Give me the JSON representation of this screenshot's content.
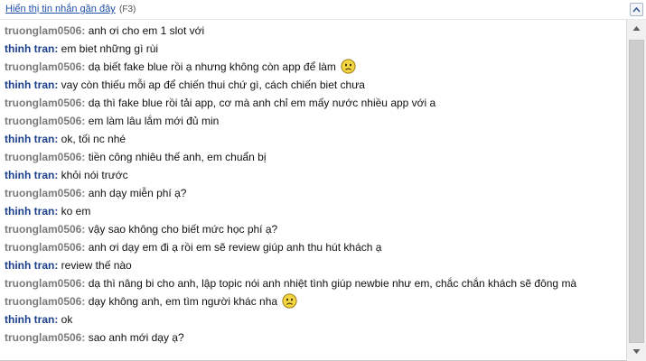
{
  "header": {
    "recent_link": "Hiển thị tin nhắn gần đây",
    "hotkey": "(F3)"
  },
  "messages": [
    {
      "sender": "truonglam0506:",
      "text": "anh ơi cho em 1 slot với",
      "role": "me"
    },
    {
      "sender": "thinh tran:",
      "text": "em biet những gì rùi",
      "role": "them"
    },
    {
      "sender": "truonglam0506:",
      "text": "dạ biết fake blue rồi ạ nhưng không còn app để làm",
      "role": "me",
      "emoticon": "sad-face"
    },
    {
      "sender": "thinh tran:",
      "text": "vay còn thiếu mỗi ap để chiến thui chứ gì, cách chiến biet chưa",
      "role": "them"
    },
    {
      "sender": "truonglam0506:",
      "text": "dạ thì fake blue rồi tải app, cơ mà anh chỉ em mấy nước nhiều app với a",
      "role": "me"
    },
    {
      "sender": "truonglam0506:",
      "text": "em làm lâu lắm mới đủ min",
      "role": "me"
    },
    {
      "sender": "thinh tran:",
      "text": "ok, tối nc nhé",
      "role": "them"
    },
    {
      "sender": "truonglam0506:",
      "text": "tiền công nhiêu thế anh, em chuẩn bị",
      "role": "me"
    },
    {
      "sender": "thinh tran:",
      "text": "khỏi nói trước",
      "role": "them"
    },
    {
      "sender": "truonglam0506:",
      "text": "anh dạy miễn phí ạ?",
      "role": "me"
    },
    {
      "sender": "thinh tran:",
      "text": "ko em",
      "role": "them"
    },
    {
      "sender": "truonglam0506:",
      "text": "vậy sao không cho biết mức học phí ạ?",
      "role": "me"
    },
    {
      "sender": "truonglam0506:",
      "text": "anh ơi dạy em đi ạ rồi em sẽ review giúp anh thu hút khách ạ",
      "role": "me"
    },
    {
      "sender": "thinh tran:",
      "text": "review thế nào",
      "role": "them"
    },
    {
      "sender": "truonglam0506:",
      "text": "dạ thì nâng bi cho anh, lập topic nói anh nhiệt tình giúp newbie như em, chắc chắn khách sẽ đông mà",
      "role": "me"
    },
    {
      "sender": "truonglam0506:",
      "text": "dạy không anh, em tìm người khác nha",
      "role": "me",
      "emoticon": "sad-face"
    },
    {
      "sender": "thinh tran:",
      "text": "ok",
      "role": "them"
    },
    {
      "sender": "truonglam0506:",
      "text": "sao anh mới dạy ạ?",
      "role": "me"
    }
  ],
  "icons": {
    "expand": "chevron-up-icon",
    "emoticon": "sad-face-icon",
    "scroll_up": "arrow-up-icon",
    "scroll_down": "arrow-down-icon"
  },
  "colors": {
    "link": "#1f4fa8",
    "sender_me": "#7a7a7a",
    "sender_them": "#1c3f8c",
    "emoticon_fill": "#f3d642"
  }
}
